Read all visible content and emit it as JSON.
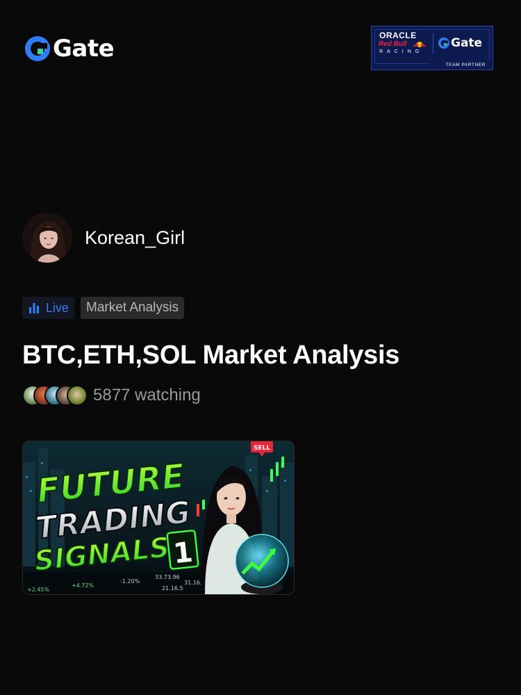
{
  "brand": {
    "name": "Gate"
  },
  "partner": {
    "oracle": "ORACLE",
    "redbull": "Red Bull",
    "racing": "RACING",
    "gate": "Gate",
    "footer": "TEAM PARTNER"
  },
  "host": {
    "name": "Korean_Girl"
  },
  "tags": {
    "live": "Live",
    "category": "Market Analysis"
  },
  "stream": {
    "title": "BTC,ETH,SOL Market Analysis",
    "watching": "5877 watching"
  },
  "thumbnail": {
    "line1": "FUTURE",
    "line2": "TRADING",
    "line3": "SIGNALS",
    "number": "1",
    "sell_badge": "SELL",
    "tickers": [
      "+2.45%",
      "+4.72%",
      "-1.20%",
      "33.73.96",
      "21.16.5",
      "31.16.5"
    ]
  },
  "colors": {
    "accent_blue": "#2f7cf6",
    "neon_green": "#39ff14",
    "sell_red": "#e8243a"
  }
}
